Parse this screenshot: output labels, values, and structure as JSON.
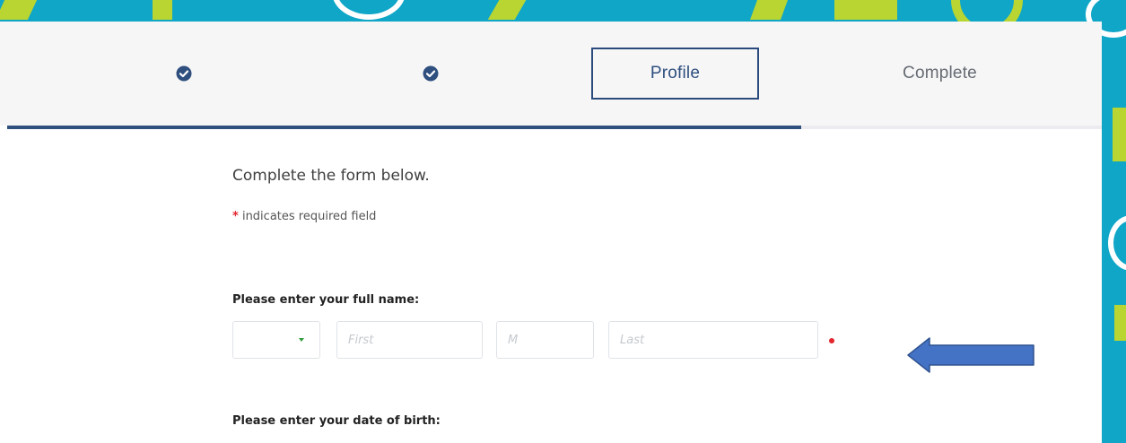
{
  "colors": {
    "primary": "#2f4f7f",
    "background_teal": "#0fa6c8",
    "accent_lime": "#b9d531",
    "required": "#e3262e",
    "annotation_arrow": "#4472c4"
  },
  "steps": [
    {
      "state": "completed",
      "icon": "check-circle-icon"
    },
    {
      "state": "completed",
      "icon": "check-circle-icon"
    },
    {
      "state": "current",
      "label": "Profile"
    },
    {
      "state": "upcoming",
      "label": "Complete"
    }
  ],
  "form": {
    "intro": "Complete the form below.",
    "required_marker": "*",
    "required_note": "indicates required field",
    "full_name": {
      "label": "Please enter your full name:",
      "prefix_value": "",
      "first_placeholder": "First",
      "middle_placeholder": "M",
      "last_placeholder": "Last",
      "required": true
    },
    "dob": {
      "label": "Please enter your date of birth:"
    }
  },
  "annotation": {
    "icon": "left-arrow-icon"
  }
}
